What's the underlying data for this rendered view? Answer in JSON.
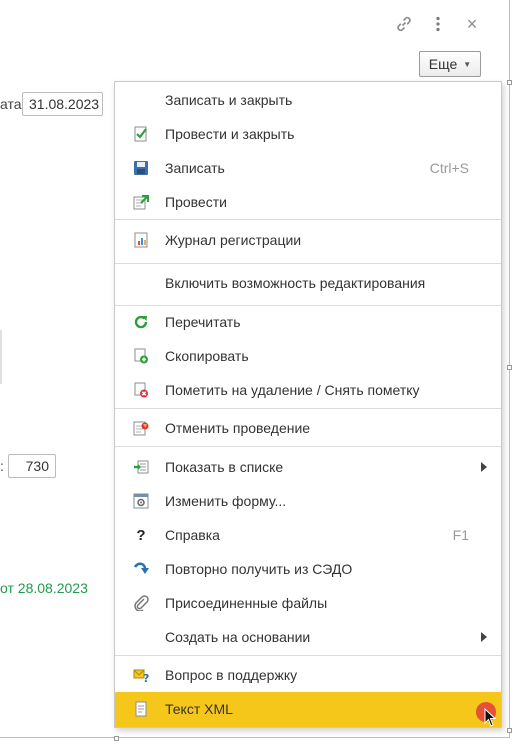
{
  "window": {
    "link_icon": "link-icon",
    "more_icon": "vertical-dots-icon",
    "close_icon": "close-icon",
    "close_glyph": "×",
    "more_button_label": "Еще"
  },
  "form": {
    "date_label": "ата:",
    "date_value": "31.08.2023",
    "number_label": ":",
    "number_value": "730",
    "doc_link": "от 28.08.2023"
  },
  "menu": {
    "items": [
      {
        "label": "Записать и закрыть",
        "icon": "none"
      },
      {
        "label": "Провести и закрыть",
        "icon": "post-close-icon"
      },
      {
        "label": "Записать",
        "icon": "save-icon",
        "shortcut": "Ctrl+S"
      },
      {
        "label": "Провести",
        "icon": "post-icon"
      },
      {
        "label": "Журнал регистрации",
        "icon": "journal-icon"
      },
      {
        "label": "Включить возможность редактирования",
        "icon": "none"
      },
      {
        "label": "Перечитать",
        "icon": "refresh-icon"
      },
      {
        "label": "Скопировать",
        "icon": "copy-icon"
      },
      {
        "label": "Пометить на удаление / Снять пометку",
        "icon": "delete-mark-icon"
      },
      {
        "label": "Отменить проведение",
        "icon": "unpost-icon"
      },
      {
        "label": "Показать в списке",
        "icon": "show-in-list-icon"
      },
      {
        "label": "Изменить форму...",
        "icon": "edit-form-icon"
      },
      {
        "label": "Справка",
        "icon": "help-icon",
        "shortcut": "F1",
        "glyph": "?"
      },
      {
        "label": "Повторно получить из СЭДО",
        "icon": "reload-arrow-icon"
      },
      {
        "label": "Присоединенные файлы",
        "icon": "paperclip-icon"
      },
      {
        "label": "Создать на основании",
        "icon": "none"
      },
      {
        "label": "Вопрос в поддержку",
        "icon": "support-question-icon"
      },
      {
        "label": "Текст XML",
        "icon": "xml-text-icon"
      }
    ]
  },
  "colors": {
    "highlight": "#f5c71b",
    "link_green": "#1e9b4e"
  }
}
